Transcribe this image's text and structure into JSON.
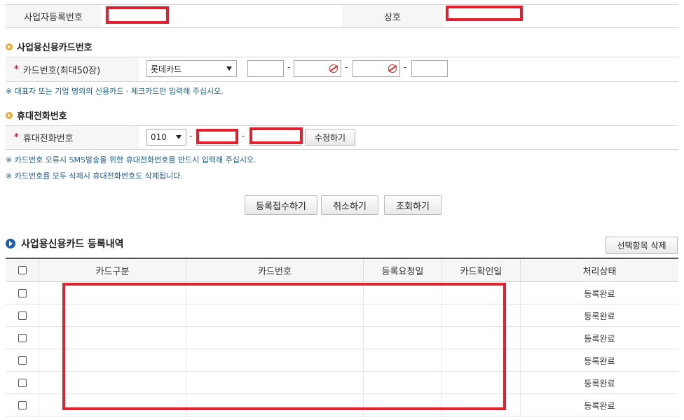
{
  "business": {
    "reg_no_label": "사업자등록번호",
    "company_label": "상호"
  },
  "card_section": {
    "title": "사업용신용카드번호",
    "card_label": "카드번호(최대50장)",
    "card_company_selected": "롯데카드",
    "note": "※ 대표자 또는 기업 명의의 신용카드 · 체크카드만 입력해 주십시오."
  },
  "phone_section": {
    "title": "휴대전화번호",
    "phone_label": "휴대전화번호",
    "prefix_selected": "010",
    "edit_button": "수정하기",
    "notes": [
      "※ 카드번호 오류시 SMS발송을 위한 휴대전화번호를 반드시 입력해 주십시오.",
      "※ 카드번호를 모두 삭제시 휴대전화번호도 삭제됩니다."
    ]
  },
  "actions": {
    "register": "등록접수하기",
    "cancel": "취소하기",
    "search": "조회하기"
  },
  "list_section": {
    "title": "사업용신용카드 등록내역",
    "delete_selected": "선택항목 삭제",
    "columns": [
      "카드구분",
      "카드번호",
      "등록요청일",
      "카드확인일",
      "처리상태"
    ],
    "rows": [
      {
        "status": "등록완료"
      },
      {
        "status": "등록완료"
      },
      {
        "status": "등록완료"
      },
      {
        "status": "등록완료"
      },
      {
        "status": "등록완료"
      },
      {
        "status": "등록완료"
      }
    ]
  },
  "colors": {
    "redaction": "#e4202e",
    "note_text": "#1a5f8f",
    "required_star": "#d9232e"
  },
  "icons": {
    "section_bullet": "orange-arrow-circle-icon",
    "list_bullet": "blue-arrow-circle-icon",
    "masked_field": "hidden-eye-icon"
  }
}
